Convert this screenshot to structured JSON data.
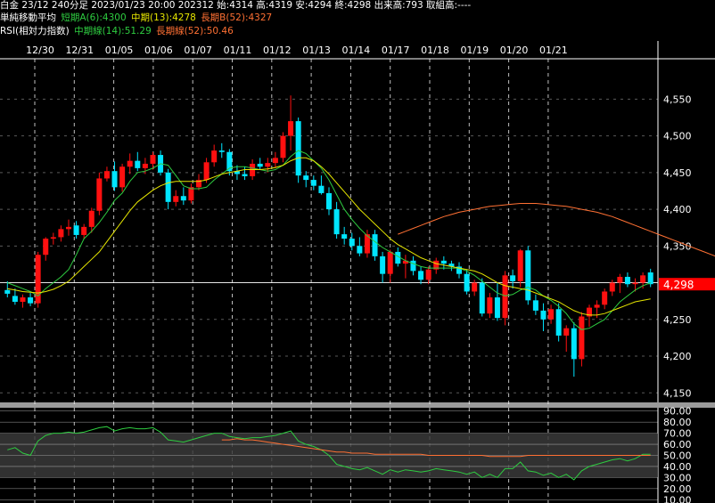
{
  "header": {
    "line1": "白金 23/12 240分足 2023/01/23 20:00 202312 始:4314 高:4319 安:4294 終:4298 出来高:793 取組高:----",
    "ma_title": "単純移動平均",
    "ma_short": "短期A(6):4300",
    "ma_mid": "中期(13):4278",
    "ma_long": "長期B(52):4327",
    "rsi_title": "RSI(相対力指数)",
    "rsi_mid": "中期線(14):51.29",
    "rsi_long": "長期線(52):50.46"
  },
  "colors": {
    "background": "#000000",
    "up": "#ff1010",
    "down": "#00e5ff",
    "ma_short": "#2ecc40",
    "ma_mid": "#e6e600",
    "ma_long": "#ff7033",
    "grid": "#ffffff",
    "rsi_band": "#3a3a3a",
    "price_tag": "#ff0000"
  },
  "chart_data": [
    {
      "type": "candlestick",
      "title": "白金 23/12 240分足",
      "x_tick_labels": [
        "12/30",
        "12/31",
        "01/05",
        "01/06",
        "01/07",
        "01/11",
        "01/12",
        "01/13",
        "01/14",
        "01/17",
        "01/18",
        "01/19",
        "01/20",
        "01/21"
      ],
      "y_ticks": [
        4150,
        4200,
        4250,
        4300,
        4350,
        4400,
        4450,
        4500,
        4550
      ],
      "y_tick_labels": [
        "4,150",
        "4,200",
        "4,250",
        "4,300",
        "4,350",
        "4,400",
        "4,450",
        "4,500",
        "4,550"
      ],
      "ylim": [
        4137,
        4605
      ],
      "last_price": 4298,
      "last_price_label": "4,298",
      "ohlc": [
        [
          4290,
          4302,
          4280,
          4285
        ],
        [
          4282,
          4292,
          4270,
          4274
        ],
        [
          4274,
          4284,
          4266,
          4280
        ],
        [
          4280,
          4286,
          4268,
          4272
        ],
        [
          4272,
          4342,
          4266,
          4338
        ],
        [
          4338,
          4362,
          4330,
          4360
        ],
        [
          4360,
          4368,
          4352,
          4362
        ],
        [
          4362,
          4378,
          4356,
          4373
        ],
        [
          4373,
          4386,
          4364,
          4376
        ],
        [
          4378,
          4384,
          4360,
          4365
        ],
        [
          4365,
          4380,
          4360,
          4376
        ],
        [
          4376,
          4402,
          4368,
          4398
        ],
        [
          4398,
          4450,
          4392,
          4442
        ],
        [
          4442,
          4458,
          4438,
          4452
        ],
        [
          4452,
          4465,
          4425,
          4430
        ],
        [
          4430,
          4462,
          4424,
          4458
        ],
        [
          4458,
          4476,
          4448,
          4466
        ],
        [
          4466,
          4478,
          4452,
          4456
        ],
        [
          4456,
          4470,
          4448,
          4462
        ],
        [
          4462,
          4478,
          4454,
          4474
        ],
        [
          4474,
          4480,
          4446,
          4450
        ],
        [
          4450,
          4455,
          4400,
          4410
        ],
        [
          4410,
          4426,
          4404,
          4418
        ],
        [
          4418,
          4430,
          4406,
          4412
        ],
        [
          4412,
          4435,
          4408,
          4430
        ],
        [
          4430,
          4448,
          4426,
          4440
        ],
        [
          4440,
          4470,
          4436,
          4464
        ],
        [
          4464,
          4488,
          4458,
          4480
        ],
        [
          4480,
          4490,
          4470,
          4478
        ],
        [
          4478,
          4482,
          4446,
          4452
        ],
        [
          4452,
          4460,
          4440,
          4448
        ],
        [
          4448,
          4458,
          4440,
          4445
        ],
        [
          4445,
          4468,
          4440,
          4462
        ],
        [
          4462,
          4470,
          4454,
          4458
        ],
        [
          4458,
          4470,
          4450,
          4463
        ],
        [
          4463,
          4478,
          4456,
          4470
        ],
        [
          4470,
          4505,
          4464,
          4500
        ],
        [
          4500,
          4555,
          4480,
          4520
        ],
        [
          4520,
          4525,
          4436,
          4446
        ],
        [
          4446,
          4452,
          4430,
          4440
        ],
        [
          4440,
          4446,
          4426,
          4432
        ],
        [
          4432,
          4446,
          4420,
          4422
        ],
        [
          4422,
          4430,
          4392,
          4400
        ],
        [
          4400,
          4410,
          4360,
          4366
        ],
        [
          4366,
          4376,
          4352,
          4360
        ],
        [
          4360,
          4368,
          4344,
          4350
        ],
        [
          4350,
          4362,
          4336,
          4340
        ],
        [
          4340,
          4372,
          4334,
          4366
        ],
        [
          4366,
          4372,
          4330,
          4336
        ],
        [
          4336,
          4342,
          4300,
          4312
        ],
        [
          4312,
          4345,
          4300,
          4342
        ],
        [
          4342,
          4348,
          4322,
          4326
        ],
        [
          4326,
          4338,
          4306,
          4330
        ],
        [
          4330,
          4336,
          4310,
          4316
        ],
        [
          4316,
          4322,
          4298,
          4304
        ],
        [
          4304,
          4322,
          4298,
          4318
        ],
        [
          4318,
          4334,
          4312,
          4330
        ],
        [
          4330,
          4336,
          4318,
          4326
        ],
        [
          4326,
          4330,
          4316,
          4322
        ],
        [
          4322,
          4328,
          4306,
          4312
        ],
        [
          4312,
          4318,
          4284,
          4288
        ],
        [
          4288,
          4304,
          4282,
          4300
        ],
        [
          4300,
          4306,
          4254,
          4258
        ],
        [
          4258,
          4286,
          4252,
          4280
        ],
        [
          4280,
          4300,
          4248,
          4252
        ],
        [
          4252,
          4316,
          4242,
          4310
        ],
        [
          4310,
          4318,
          4292,
          4302
        ],
        [
          4302,
          4346,
          4294,
          4344
        ],
        [
          4344,
          4350,
          4270,
          4276
        ],
        [
          4276,
          4284,
          4256,
          4262
        ],
        [
          4262,
          4272,
          4234,
          4250
        ],
        [
          4250,
          4270,
          4244,
          4264
        ],
        [
          4264,
          4272,
          4220,
          4228
        ],
        [
          4228,
          4242,
          4206,
          4238
        ],
        [
          4238,
          4246,
          4172,
          4196
        ],
        [
          4196,
          4260,
          4186,
          4254
        ],
        [
          4254,
          4270,
          4240,
          4266
        ],
        [
          4266,
          4276,
          4252,
          4270
        ],
        [
          4270,
          4292,
          4264,
          4288
        ],
        [
          4288,
          4304,
          4282,
          4300
        ],
        [
          4300,
          4312,
          4286,
          4308
        ],
        [
          4308,
          4314,
          4294,
          4298
        ],
        [
          4298,
          4306,
          4288,
          4300
        ],
        [
          4300,
          4314,
          4292,
          4310
        ],
        [
          4314,
          4319,
          4294,
          4298
        ]
      ],
      "series": [
        {
          "name": "短期A(6)",
          "values": [
            4300,
            4296,
            4292,
            4288,
            4282,
            4292,
            4300,
            4308,
            4318,
            4338,
            4360,
            4370,
            4382,
            4396,
            4412,
            4422,
            4438,
            4450,
            4452,
            4456,
            4462,
            4460,
            4446,
            4432,
            4428,
            4428,
            4430,
            4440,
            4448,
            4456,
            4458,
            4458,
            4456,
            4454,
            4452,
            4454,
            4460,
            4472,
            4480,
            4476,
            4466,
            4456,
            4440,
            4420,
            4400,
            4386,
            4374,
            4364,
            4356,
            4348,
            4342,
            4336,
            4330,
            4326,
            4322,
            4320,
            4320,
            4320,
            4320,
            4320,
            4316,
            4310,
            4302,
            4294,
            4286,
            4282,
            4284,
            4290,
            4294,
            4290,
            4282,
            4276,
            4268,
            4258,
            4244,
            4236,
            4238,
            4244,
            4250,
            4262,
            4274,
            4282,
            4290,
            4296,
            4300
          ]
        },
        {
          "name": "中期(13)",
          "values": [
            4292,
            4290,
            4288,
            4287,
            4286,
            4288,
            4291,
            4296,
            4302,
            4312,
            4322,
            4332,
            4342,
            4356,
            4370,
            4384,
            4398,
            4410,
            4418,
            4426,
            4432,
            4436,
            4438,
            4438,
            4438,
            4438,
            4440,
            4444,
            4448,
            4450,
            4452,
            4454,
            4454,
            4454,
            4455,
            4457,
            4460,
            4466,
            4470,
            4470,
            4466,
            4458,
            4448,
            4436,
            4424,
            4412,
            4400,
            4390,
            4380,
            4370,
            4360,
            4352,
            4346,
            4340,
            4334,
            4330,
            4326,
            4324,
            4322,
            4320,
            4318,
            4316,
            4312,
            4306,
            4300,
            4296,
            4294,
            4292,
            4290,
            4286,
            4282,
            4278,
            4274,
            4268,
            4262,
            4258,
            4256,
            4256,
            4258,
            4262,
            4266,
            4270,
            4274,
            4276,
            4278
          ]
        },
        {
          "name": "長期B(52)",
          "start": 51,
          "values": [
            4366,
            4370,
            4374,
            4378,
            4382,
            4386,
            4390,
            4393,
            4396,
            4398,
            4400,
            4402,
            4404,
            4405,
            4406,
            4407,
            4408,
            4408,
            4408,
            4407,
            4406,
            4405,
            4404,
            4402,
            4400,
            4398,
            4396,
            4393,
            4390,
            4386,
            4382,
            4378,
            4374,
            4370,
            4366,
            4362,
            4358,
            4354,
            4350,
            4346,
            4342,
            4338,
            4334,
            4330
          ]
        }
      ]
    },
    {
      "type": "line",
      "title": "RSI(相対力指数)",
      "y_ticks": [
        10,
        20,
        30,
        40,
        50,
        60,
        70,
        80,
        90
      ],
      "y_tick_labels": [
        "10.00",
        "20.00",
        "30.00",
        "40.00",
        "50.00",
        "60.00",
        "70.00",
        "80.00",
        "90.00"
      ],
      "ylim": [
        7,
        93
      ],
      "band": [
        30,
        70
      ],
      "series": [
        {
          "name": "中期線(14)",
          "values": [
            55,
            57,
            52,
            50,
            63,
            68,
            70,
            70,
            71,
            70,
            71,
            73,
            75,
            76,
            72,
            74,
            75,
            74,
            74,
            75,
            71,
            64,
            63,
            62,
            64,
            66,
            68,
            70,
            70,
            67,
            66,
            65,
            66,
            66,
            67,
            68,
            70,
            72,
            63,
            60,
            58,
            55,
            50,
            42,
            40,
            38,
            37,
            39,
            36,
            33,
            37,
            35,
            37,
            36,
            35,
            36,
            38,
            37,
            36,
            35,
            33,
            35,
            30,
            33,
            30,
            38,
            38,
            44,
            36,
            35,
            32,
            34,
            30,
            33,
            28,
            36,
            40,
            42,
            44,
            46,
            47,
            45,
            47,
            51,
            51
          ]
        },
        {
          "name": "長期線(52)",
          "start": 28,
          "values": [
            64,
            64,
            65,
            64,
            64,
            63,
            62,
            61,
            60,
            59,
            58,
            57,
            56,
            55,
            54,
            53,
            53,
            52,
            52,
            52,
            51,
            51,
            51,
            51,
            51,
            51,
            51,
            50,
            50,
            50,
            50,
            50,
            50,
            50,
            50,
            49,
            49,
            49,
            49,
            49,
            50,
            50,
            50,
            50,
            50,
            50,
            50,
            50,
            50,
            50,
            50,
            50,
            50,
            50,
            50,
            50,
            50
          ]
        }
      ]
    }
  ]
}
